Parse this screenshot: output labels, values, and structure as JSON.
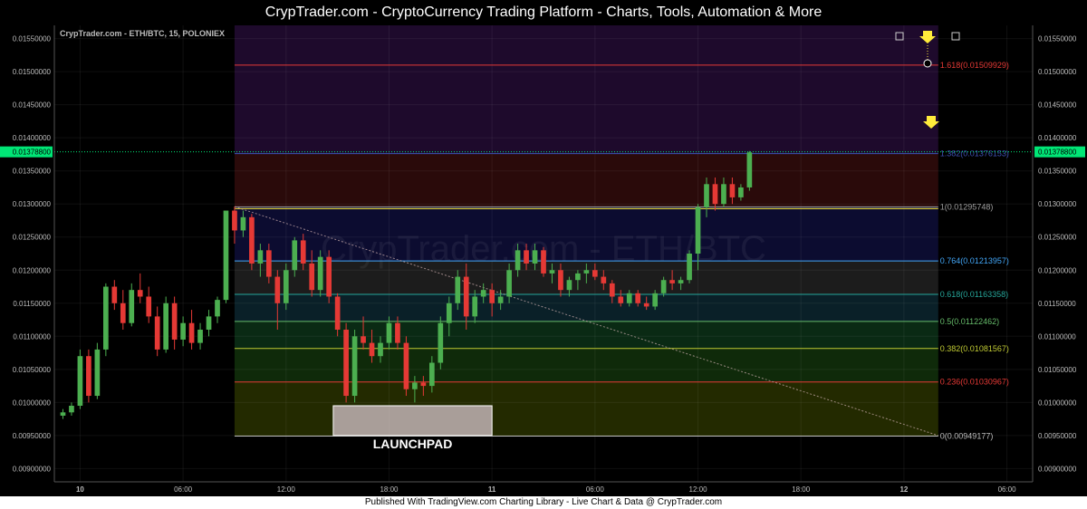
{
  "header": {
    "title": "CrypTrader.com  -  CryptoCurrency Trading Platform  -  Charts, Tools, Automation & More"
  },
  "chart": {
    "symbol_line": "CrypTrader.com - ETH/BTC, 15, POLONIEX",
    "watermark": "CrypTrader.com - ETH/BTC",
    "launchpad_label": "LAUNCHPAD"
  },
  "footer": {
    "text": "Published With TradingView.com Charting Library - Live Chart & Data @ CrypTrader.com"
  },
  "chart_data": {
    "type": "candlestick",
    "symbol": "ETH/BTC",
    "interval": "15",
    "exchange": "POLONIEX",
    "last_price": "0.01378800",
    "ylim": [
      0.0088,
      0.0157
    ],
    "yticks": [
      "0.01550000",
      "0.01500000",
      "0.01450000",
      "0.01400000",
      "0.01350000",
      "0.01300000",
      "0.01250000",
      "0.01200000",
      "0.01150000",
      "0.01100000",
      "0.01050000",
      "0.01000000",
      "0.00950000",
      "0.00900000"
    ],
    "xticks": [
      {
        "label": "10",
        "t": 4
      },
      {
        "label": "06:00",
        "t": 28
      },
      {
        "label": "12:00",
        "t": 52
      },
      {
        "label": "18:00",
        "t": 76
      },
      {
        "label": "11",
        "t": 100
      },
      {
        "label": "06:00",
        "t": 124
      },
      {
        "label": "12:00",
        "t": 148
      },
      {
        "label": "18:00",
        "t": 172
      },
      {
        "label": "12",
        "t": 196
      },
      {
        "label": "06:00",
        "t": 220
      }
    ],
    "fib_levels": [
      {
        "ratio": "0",
        "price": 0.00949177,
        "label": "0(0.00949177)",
        "color": "#bdbdbd",
        "fill": "#2a0a0a"
      },
      {
        "ratio": "0.236",
        "price": 0.01030967,
        "label": "0.236(0.01030967)",
        "color": "#e53935",
        "fill": "#232a00"
      },
      {
        "ratio": "0.382",
        "price": 0.01081567,
        "label": "0.382(0.01081567)",
        "color": "#c0ca33",
        "fill": "#0f2a0a"
      },
      {
        "ratio": "0.5",
        "price": 0.01122462,
        "label": "0.5(0.01122462)",
        "color": "#66bb6a",
        "fill": "#0a2a14"
      },
      {
        "ratio": "0.618",
        "price": 0.01163358,
        "label": "0.618(0.01163358)",
        "color": "#26a69a",
        "fill": "#0a2028"
      },
      {
        "ratio": "0.764",
        "price": 0.01213957,
        "label": "0.764(0.01213957)",
        "color": "#42a5f5",
        "fill": "#1c1c1c"
      },
      {
        "ratio": "1",
        "price": 0.01295748,
        "label": "1(0.01295748)",
        "color": "#9e9e9e",
        "fill": "#0c0c30"
      },
      {
        "ratio": "1.382",
        "price": 0.01376153,
        "label": "1.382(0.01376153)",
        "color": "#3f51b5",
        "fill": "#2a0a0a"
      },
      {
        "ratio": "1.618",
        "price": 0.01509929,
        "label": "1.618(0.01509929)",
        "color": "#e53935",
        "fill": "#1e0a2c"
      }
    ],
    "fib_range_t": [
      40,
      204
    ],
    "launchpad": {
      "t0": 63,
      "t1": 100,
      "p0": 0.0095,
      "p1": 0.00995
    },
    "trendline": {
      "t0": 40,
      "p0": 0.01296,
      "t1": 204,
      "p1": 0.0095
    },
    "horizontal_line": {
      "price": 0.01293,
      "t0": 40,
      "t1": 204
    },
    "candles": [
      {
        "t": 0,
        "o": 0.0098,
        "h": 0.0099,
        "l": 0.00975,
        "c": 0.00985
      },
      {
        "t": 2,
        "o": 0.00985,
        "h": 0.01,
        "l": 0.0098,
        "c": 0.00995
      },
      {
        "t": 4,
        "o": 0.00995,
        "h": 0.0108,
        "l": 0.0099,
        "c": 0.0107
      },
      {
        "t": 6,
        "o": 0.0107,
        "h": 0.0108,
        "l": 0.01,
        "c": 0.0101
      },
      {
        "t": 8,
        "o": 0.0101,
        "h": 0.0109,
        "l": 0.01005,
        "c": 0.0108
      },
      {
        "t": 10,
        "o": 0.0108,
        "h": 0.0118,
        "l": 0.0107,
        "c": 0.01175
      },
      {
        "t": 12,
        "o": 0.01175,
        "h": 0.01185,
        "l": 0.0114,
        "c": 0.0115
      },
      {
        "t": 14,
        "o": 0.0115,
        "h": 0.0117,
        "l": 0.0111,
        "c": 0.0112
      },
      {
        "t": 16,
        "o": 0.0112,
        "h": 0.0118,
        "l": 0.01115,
        "c": 0.0117
      },
      {
        "t": 18,
        "o": 0.0117,
        "h": 0.01195,
        "l": 0.0115,
        "c": 0.0116
      },
      {
        "t": 20,
        "o": 0.0116,
        "h": 0.01175,
        "l": 0.0112,
        "c": 0.0113
      },
      {
        "t": 22,
        "o": 0.0113,
        "h": 0.01145,
        "l": 0.0107,
        "c": 0.0108
      },
      {
        "t": 24,
        "o": 0.0108,
        "h": 0.0116,
        "l": 0.01075,
        "c": 0.0115
      },
      {
        "t": 26,
        "o": 0.0115,
        "h": 0.0116,
        "l": 0.0108,
        "c": 0.01095
      },
      {
        "t": 28,
        "o": 0.01095,
        "h": 0.0113,
        "l": 0.01085,
        "c": 0.0112
      },
      {
        "t": 30,
        "o": 0.0112,
        "h": 0.0114,
        "l": 0.0108,
        "c": 0.0109
      },
      {
        "t": 32,
        "o": 0.0109,
        "h": 0.0112,
        "l": 0.0108,
        "c": 0.0111
      },
      {
        "t": 34,
        "o": 0.0111,
        "h": 0.0114,
        "l": 0.011,
        "c": 0.0113
      },
      {
        "t": 36,
        "o": 0.0113,
        "h": 0.0116,
        "l": 0.0112,
        "c": 0.01155
      },
      {
        "t": 38,
        "o": 0.01155,
        "h": 0.0129,
        "l": 0.0115,
        "c": 0.0129
      },
      {
        "t": 40,
        "o": 0.0129,
        "h": 0.01296,
        "l": 0.0124,
        "c": 0.0126
      },
      {
        "t": 42,
        "o": 0.0126,
        "h": 0.0129,
        "l": 0.0125,
        "c": 0.0128
      },
      {
        "t": 44,
        "o": 0.0128,
        "h": 0.01285,
        "l": 0.012,
        "c": 0.0121
      },
      {
        "t": 46,
        "o": 0.0121,
        "h": 0.0124,
        "l": 0.0119,
        "c": 0.0123
      },
      {
        "t": 48,
        "o": 0.0123,
        "h": 0.0124,
        "l": 0.0118,
        "c": 0.0119
      },
      {
        "t": 50,
        "o": 0.0119,
        "h": 0.012,
        "l": 0.0111,
        "c": 0.0115
      },
      {
        "t": 52,
        "o": 0.0115,
        "h": 0.0121,
        "l": 0.0114,
        "c": 0.012
      },
      {
        "t": 54,
        "o": 0.012,
        "h": 0.0125,
        "l": 0.0119,
        "c": 0.01245
      },
      {
        "t": 56,
        "o": 0.01245,
        "h": 0.01255,
        "l": 0.012,
        "c": 0.0121
      },
      {
        "t": 58,
        "o": 0.0121,
        "h": 0.0123,
        "l": 0.0116,
        "c": 0.0117
      },
      {
        "t": 60,
        "o": 0.0117,
        "h": 0.0123,
        "l": 0.0116,
        "c": 0.0122
      },
      {
        "t": 62,
        "o": 0.0122,
        "h": 0.0123,
        "l": 0.0115,
        "c": 0.0116
      },
      {
        "t": 64,
        "o": 0.0116,
        "h": 0.01165,
        "l": 0.011,
        "c": 0.0111
      },
      {
        "t": 66,
        "o": 0.0111,
        "h": 0.0112,
        "l": 0.01,
        "c": 0.0101
      },
      {
        "t": 68,
        "o": 0.0101,
        "h": 0.0111,
        "l": 0.01,
        "c": 0.011
      },
      {
        "t": 70,
        "o": 0.011,
        "h": 0.0113,
        "l": 0.0108,
        "c": 0.0109
      },
      {
        "t": 72,
        "o": 0.0109,
        "h": 0.0111,
        "l": 0.0106,
        "c": 0.0107
      },
      {
        "t": 74,
        "o": 0.0107,
        "h": 0.011,
        "l": 0.0106,
        "c": 0.0109
      },
      {
        "t": 76,
        "o": 0.0109,
        "h": 0.0113,
        "l": 0.0108,
        "c": 0.0112
      },
      {
        "t": 78,
        "o": 0.0112,
        "h": 0.0113,
        "l": 0.0108,
        "c": 0.0109
      },
      {
        "t": 80,
        "o": 0.0109,
        "h": 0.011,
        "l": 0.0101,
        "c": 0.0102
      },
      {
        "t": 82,
        "o": 0.0102,
        "h": 0.0104,
        "l": 0.01,
        "c": 0.0103
      },
      {
        "t": 84,
        "o": 0.0103,
        "h": 0.0104,
        "l": 0.0101,
        "c": 0.01025
      },
      {
        "t": 86,
        "o": 0.01025,
        "h": 0.0107,
        "l": 0.01015,
        "c": 0.0106
      },
      {
        "t": 88,
        "o": 0.0106,
        "h": 0.0113,
        "l": 0.0105,
        "c": 0.0112
      },
      {
        "t": 90,
        "o": 0.0112,
        "h": 0.0116,
        "l": 0.011,
        "c": 0.0115
      },
      {
        "t": 92,
        "o": 0.0115,
        "h": 0.012,
        "l": 0.0114,
        "c": 0.0119
      },
      {
        "t": 94,
        "o": 0.0119,
        "h": 0.0121,
        "l": 0.0111,
        "c": 0.0113
      },
      {
        "t": 96,
        "o": 0.0113,
        "h": 0.0117,
        "l": 0.0112,
        "c": 0.0116
      },
      {
        "t": 98,
        "o": 0.0116,
        "h": 0.0118,
        "l": 0.0115,
        "c": 0.0117
      },
      {
        "t": 100,
        "o": 0.0117,
        "h": 0.0118,
        "l": 0.0113,
        "c": 0.0115
      },
      {
        "t": 102,
        "o": 0.0115,
        "h": 0.0117,
        "l": 0.0114,
        "c": 0.0116
      },
      {
        "t": 104,
        "o": 0.0116,
        "h": 0.0121,
        "l": 0.0115,
        "c": 0.012
      },
      {
        "t": 106,
        "o": 0.012,
        "h": 0.0124,
        "l": 0.0119,
        "c": 0.0123
      },
      {
        "t": 108,
        "o": 0.0123,
        "h": 0.0124,
        "l": 0.012,
        "c": 0.0121
      },
      {
        "t": 110,
        "o": 0.0121,
        "h": 0.0124,
        "l": 0.012,
        "c": 0.0123
      },
      {
        "t": 112,
        "o": 0.0123,
        "h": 0.01235,
        "l": 0.0119,
        "c": 0.01195
      },
      {
        "t": 114,
        "o": 0.01195,
        "h": 0.0121,
        "l": 0.0118,
        "c": 0.012
      },
      {
        "t": 116,
        "o": 0.012,
        "h": 0.0121,
        "l": 0.0116,
        "c": 0.0117
      },
      {
        "t": 118,
        "o": 0.0117,
        "h": 0.0119,
        "l": 0.0116,
        "c": 0.01185
      },
      {
        "t": 120,
        "o": 0.01185,
        "h": 0.012,
        "l": 0.0117,
        "c": 0.01195
      },
      {
        "t": 122,
        "o": 0.01195,
        "h": 0.0121,
        "l": 0.0118,
        "c": 0.012
      },
      {
        "t": 124,
        "o": 0.012,
        "h": 0.0121,
        "l": 0.01185,
        "c": 0.0119
      },
      {
        "t": 126,
        "o": 0.0119,
        "h": 0.012,
        "l": 0.0117,
        "c": 0.0118
      },
      {
        "t": 128,
        "o": 0.0118,
        "h": 0.01185,
        "l": 0.0115,
        "c": 0.0116
      },
      {
        "t": 130,
        "o": 0.0116,
        "h": 0.0117,
        "l": 0.01145,
        "c": 0.0115
      },
      {
        "t": 132,
        "o": 0.0115,
        "h": 0.0117,
        "l": 0.01145,
        "c": 0.01165
      },
      {
        "t": 134,
        "o": 0.01165,
        "h": 0.0117,
        "l": 0.01145,
        "c": 0.0115
      },
      {
        "t": 136,
        "o": 0.0115,
        "h": 0.0116,
        "l": 0.0114,
        "c": 0.01145
      },
      {
        "t": 138,
        "o": 0.01145,
        "h": 0.0117,
        "l": 0.0114,
        "c": 0.01165
      },
      {
        "t": 140,
        "o": 0.01165,
        "h": 0.0119,
        "l": 0.0116,
        "c": 0.01185
      },
      {
        "t": 142,
        "o": 0.01185,
        "h": 0.012,
        "l": 0.0117,
        "c": 0.0118
      },
      {
        "t": 144,
        "o": 0.0118,
        "h": 0.0119,
        "l": 0.0117,
        "c": 0.01185
      },
      {
        "t": 146,
        "o": 0.01185,
        "h": 0.0123,
        "l": 0.0118,
        "c": 0.01225
      },
      {
        "t": 148,
        "o": 0.01225,
        "h": 0.013,
        "l": 0.012,
        "c": 0.01295
      },
      {
        "t": 150,
        "o": 0.01295,
        "h": 0.0134,
        "l": 0.0128,
        "c": 0.0133
      },
      {
        "t": 152,
        "o": 0.0133,
        "h": 0.0134,
        "l": 0.0129,
        "c": 0.013
      },
      {
        "t": 154,
        "o": 0.013,
        "h": 0.0134,
        "l": 0.01295,
        "c": 0.0133
      },
      {
        "t": 156,
        "o": 0.0133,
        "h": 0.0134,
        "l": 0.013,
        "c": 0.0131
      },
      {
        "t": 158,
        "o": 0.0131,
        "h": 0.0133,
        "l": 0.01305,
        "c": 0.01325
      },
      {
        "t": 160,
        "o": 0.01325,
        "h": 0.0138,
        "l": 0.0132,
        "c": 0.01378
      }
    ]
  }
}
